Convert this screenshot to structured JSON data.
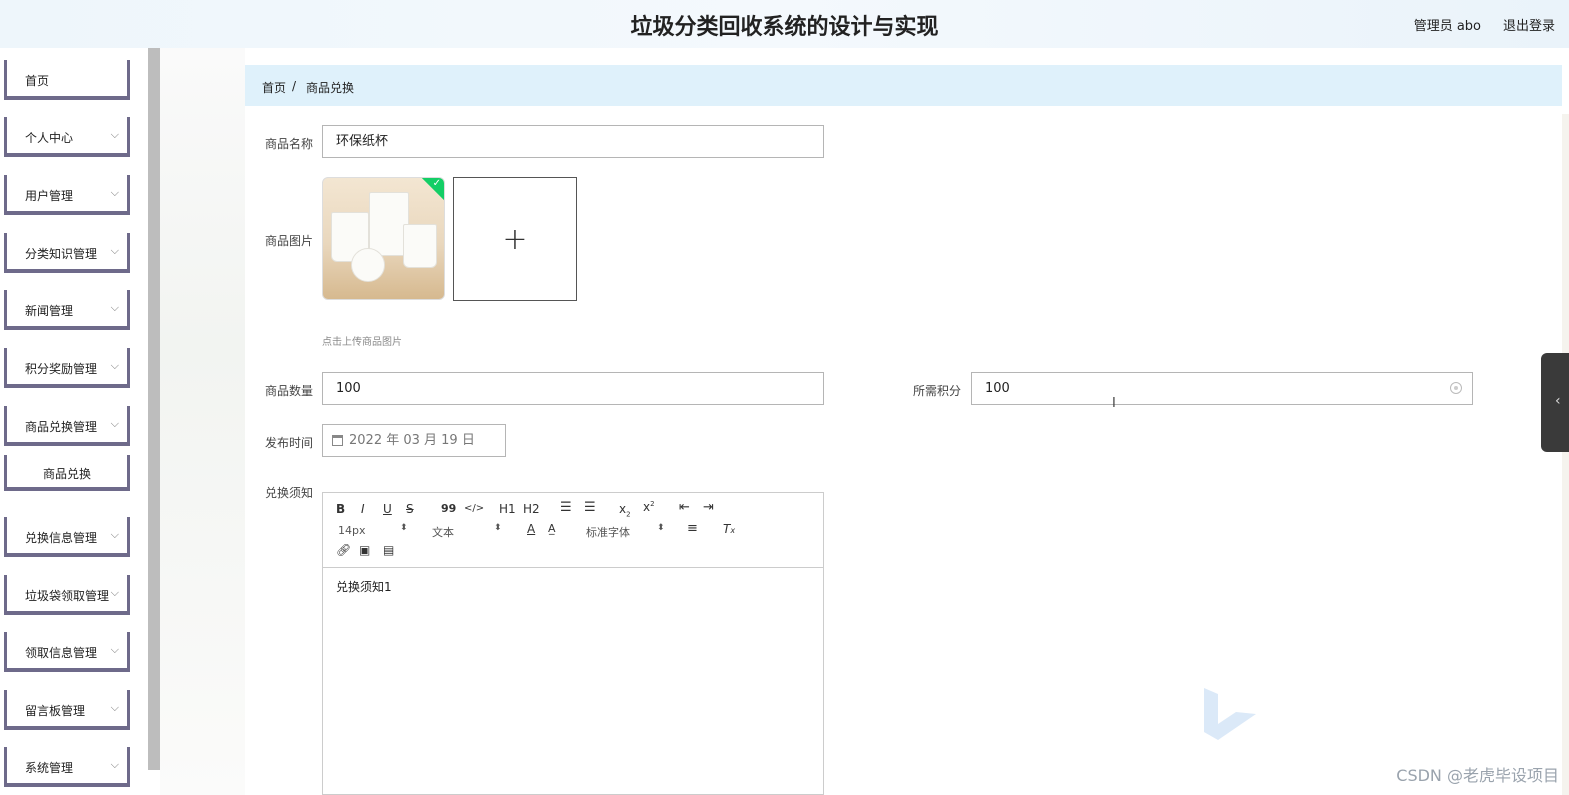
{
  "header": {
    "title": "垃圾分类回收系统的设计与实现",
    "user": "管理员 abo",
    "logout": "退出登录"
  },
  "sidebar": {
    "items": [
      {
        "label": "首页",
        "has_chevron": false
      },
      {
        "label": "个人中心",
        "has_chevron": true
      },
      {
        "label": "用户管理",
        "has_chevron": true
      },
      {
        "label": "分类知识管理",
        "has_chevron": true
      },
      {
        "label": "新闻管理",
        "has_chevron": true
      },
      {
        "label": "积分奖励管理",
        "has_chevron": true
      },
      {
        "label": "商品兑换管理",
        "has_chevron": true
      },
      {
        "label": "商品兑换",
        "has_chevron": false,
        "submenu": true
      },
      {
        "label": "兑换信息管理",
        "has_chevron": true
      },
      {
        "label": "垃圾袋领取管理",
        "has_chevron": true
      },
      {
        "label": "领取信息管理",
        "has_chevron": true
      },
      {
        "label": "留言板管理",
        "has_chevron": true
      },
      {
        "label": "系统管理",
        "has_chevron": true
      }
    ]
  },
  "breadcrumb": {
    "home": "首页",
    "sep": "/",
    "current": "商品兑换"
  },
  "form": {
    "name_label": "商品名称",
    "name_value": "环保纸杯",
    "image_label": "商品图片",
    "upload_hint": "点击上传商品图片",
    "upload_plus": "+",
    "qty_label": "商品数量",
    "qty_value": "100",
    "points_label": "所需积分",
    "points_value": "100",
    "date_label": "发布时间",
    "date_value": "2022 年 03 月 19 日",
    "notice_label": "兑换须知"
  },
  "editor": {
    "toolbar_row1": [
      "B",
      "I",
      "U",
      "S",
      "99",
      "</>",
      "H1",
      "H2",
      "OL",
      "UL",
      "x2",
      "x2",
      "outdent",
      "indent"
    ],
    "font_size": "14px",
    "paragraph": "文本",
    "font_family": "标准字体",
    "content": "兑换须知1"
  },
  "watermark": "CSDN @老虎毕设项目",
  "colors": {
    "breadcrumb_bg": "#dff1fb",
    "menu_border": "#6e6a8a",
    "upload_success": "#13ce66"
  }
}
